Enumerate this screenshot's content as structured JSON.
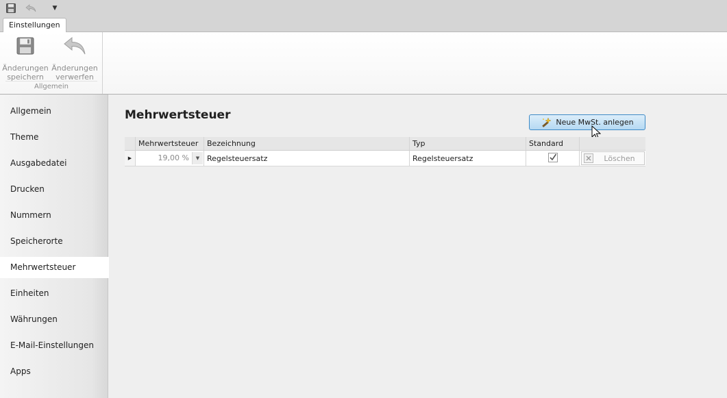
{
  "quick_access": {
    "save_icon": "floppy-disk-icon",
    "undo_icon": "undo-arrow-icon",
    "more_icon": "dropdown-arrow-icon",
    "more_glyph": "▼"
  },
  "ribbon": {
    "tab_label": "Einstellungen",
    "group_label": "Allgemein",
    "save_button": {
      "line1": "Änderungen",
      "line2": "speichern",
      "icon": "floppy-disk-icon"
    },
    "discard_button": {
      "line1": "Änderungen",
      "line2": "verwerfen",
      "icon": "undo-arrow-icon"
    }
  },
  "sidebar": {
    "active_index": 6,
    "items": [
      {
        "label": "Allgemein"
      },
      {
        "label": "Theme"
      },
      {
        "label": "Ausgabedatei"
      },
      {
        "label": "Drucken"
      },
      {
        "label": "Nummern"
      },
      {
        "label": "Speicherorte"
      },
      {
        "label": "Mehrwertsteuer"
      },
      {
        "label": "Einheiten"
      },
      {
        "label": "Währungen"
      },
      {
        "label": "E-Mail-Einstellungen"
      },
      {
        "label": "Apps"
      }
    ]
  },
  "main": {
    "title": "Mehrwertsteuer",
    "new_button_label": "Neue MwSt. anlegen",
    "new_button_icon": "wand-sparkle-icon",
    "grid": {
      "columns": [
        "Mehrwertsteuer",
        "Bezeichnung",
        "Typ",
        "Standard",
        ""
      ],
      "rows": [
        {
          "indicator": "▶",
          "mwst": "19,00 %",
          "dropdown_glyph": "▼",
          "bezeichnung": "Regelsteuersatz",
          "typ": "Regelsteuersatz",
          "standard": true,
          "delete_label": "Löschen"
        }
      ]
    }
  },
  "colors": {
    "accent_border": "#3d8ac6",
    "accent_fill": "#b4d8f2",
    "active_item_bg": "#ffffff",
    "disabled_text": "#8c8c8c"
  }
}
